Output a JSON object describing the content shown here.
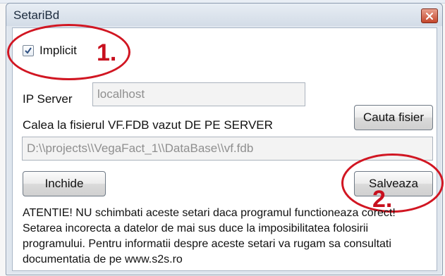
{
  "window": {
    "title": "SetariBd"
  },
  "implicit": {
    "label": "Implicit",
    "checked": true,
    "annotation": "1."
  },
  "server": {
    "label": "IP Server",
    "value": "localhost"
  },
  "path": {
    "label": "Calea la fisierul VF.FDB vazut DE PE SERVER",
    "value": "D:\\\\projects\\\\VegaFact_1\\\\DataBase\\\\vf.fdb"
  },
  "buttons": {
    "browse": "Cauta fisier",
    "close": "Inchide",
    "save": "Salveaza",
    "save_annotation": "2."
  },
  "warning": {
    "line1": "ATENTIE! NU schimbati aceste setari daca programul functioneaza corect!",
    "line2": "Setarea incorecta a datelor de mai sus duce la imposibilitatea folosirii",
    "line3": "programului.  Pentru informatii despre aceste setari va rugam sa consultati",
    "line4": "documentatia de pe www.s2s.ro"
  },
  "colors": {
    "annotation": "#d11622",
    "close_button": "#c4462b"
  },
  "icons": {
    "close": "close-icon",
    "checkbox": "check-icon"
  }
}
